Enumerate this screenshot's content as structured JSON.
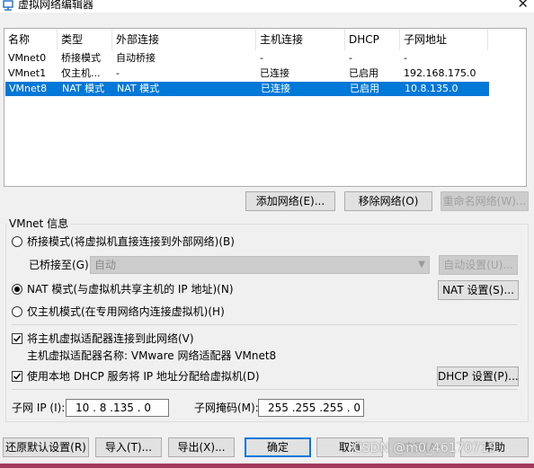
{
  "window": {
    "title": "虚拟网络编辑器",
    "close": "✕"
  },
  "table": {
    "headers": [
      "名称",
      "类型",
      "外部连接",
      "主机连接",
      "DHCP",
      "子网地址"
    ],
    "rows": [
      [
        "VMnet0",
        "桥接模式",
        "自动桥接",
        "-",
        "-",
        "-"
      ],
      [
        "VMnet1",
        "仅主机...",
        "-",
        "已连接",
        "已启用",
        "192.168.175.0"
      ],
      [
        "VMnet8",
        "NAT 模式",
        "NAT 模式",
        "已连接",
        "已启用",
        "10.8.135.0"
      ]
    ],
    "selected_row": 2
  },
  "network_buttons": {
    "add": "添加网络(E)...",
    "remove": "移除网络(O)",
    "rename": "重命名网络(W)..."
  },
  "vmnet_info": {
    "title": "VMnet 信息",
    "bridged_label": "桥接模式(将虚拟机直接连接到外部网络)(B)",
    "bridged_to_label": "已桥接至(G):",
    "bridged_to_value": "自动",
    "auto_settings": "自动设置(U)...",
    "nat_label": "NAT 模式(与虚拟机共享主机的 IP 地址)(N)",
    "nat_settings": "NAT 设置(S)...",
    "hostonly_label": "仅主机模式(在专用网络内连接虚拟机)(H)",
    "selected_mode": "nat",
    "connect_adapter_label": "将主机虚拟适配器连接到此网络(V)",
    "connect_adapter_checked": true,
    "adapter_name": "主机虚拟适配器名称: VMware 网络适配器 VMnet8",
    "dhcp_label": "使用本地 DHCP 服务将 IP 地址分配给虚拟机(D)",
    "dhcp_checked": true,
    "dhcp_settings": "DHCP 设置(P)...",
    "subnet_ip_label": "子网 IP (I):",
    "subnet_ip_value": "10 . 8 .135 . 0",
    "subnet_mask_label": "子网掩码(M):",
    "subnet_mask_value": "255 .255 .255 . 0"
  },
  "footer_buttons": {
    "restore": "还原默认设置(R)",
    "import": "导入(T)...",
    "export": "导出(X)...",
    "ok": "确定",
    "cancel": "取消",
    "apply": "应用(A)",
    "help": "帮助"
  },
  "watermark": "CSDN @m0_46170719",
  "colors": {
    "selection": "#0078d7",
    "background": "#f0f0f0"
  }
}
